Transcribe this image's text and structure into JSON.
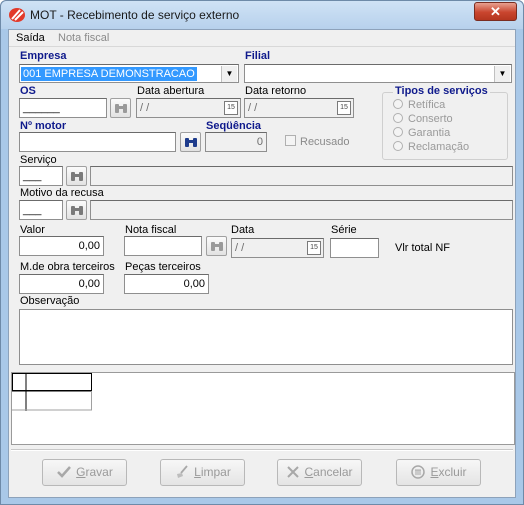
{
  "window": {
    "title": "MOT - Recebimento de serviço externo",
    "close_glyph": "✕"
  },
  "menu": {
    "items": [
      {
        "label": "Saída"
      },
      {
        "label": "Nota fiscal"
      }
    ]
  },
  "empresa": {
    "label": "Empresa",
    "value": "001 EMPRESA DEMONSTRACAO"
  },
  "filial": {
    "label": "Filial",
    "value": ""
  },
  "os": {
    "label": "OS",
    "value": "______"
  },
  "data_abertura": {
    "label": "Data abertura",
    "value": "/ /"
  },
  "data_retorno": {
    "label": "Data retorno",
    "value": "/ /"
  },
  "tipos": {
    "title": "Tipos de serviços",
    "options": [
      {
        "label": "Retífica"
      },
      {
        "label": "Conserto"
      },
      {
        "label": "Garantia"
      },
      {
        "label": "Reclamação"
      }
    ]
  },
  "motor": {
    "label": "Nº  motor",
    "value": ""
  },
  "sequencia": {
    "label": "Seqüência",
    "value": "0"
  },
  "recusado": {
    "label": "Recusado"
  },
  "servico": {
    "label": "Serviço",
    "code": "___",
    "description": ""
  },
  "motivo": {
    "label": "Motivo da recusa",
    "code": "___",
    "description": ""
  },
  "valor": {
    "label": "Valor",
    "value": "0,00"
  },
  "nota_fiscal": {
    "label": "Nota fiscal",
    "value": ""
  },
  "data": {
    "label": "Data",
    "value": "/ /"
  },
  "serie": {
    "label": "Série",
    "value": ""
  },
  "vlr_total_nf": {
    "label": "Vlr total NF"
  },
  "mao_obra": {
    "label": "M.de obra terceiros",
    "value": "0,00"
  },
  "pecas": {
    "label": "Peças terceiros",
    "value": "0,00"
  },
  "observacao": {
    "label": "Observação",
    "value": ""
  },
  "actions": {
    "gravar": {
      "accel": "G",
      "rest": "ravar"
    },
    "limpar": {
      "accel": "L",
      "rest": "impar"
    },
    "cancelar": {
      "accel": "C",
      "rest": "ancelar"
    },
    "excluir": {
      "accel": "E",
      "rest": "xcluir"
    }
  },
  "colors": {
    "title_bar": "#b7d1ec",
    "label_blue": "#0f1a8c",
    "selection": "#3399ff",
    "close_red": "#c9452e"
  }
}
